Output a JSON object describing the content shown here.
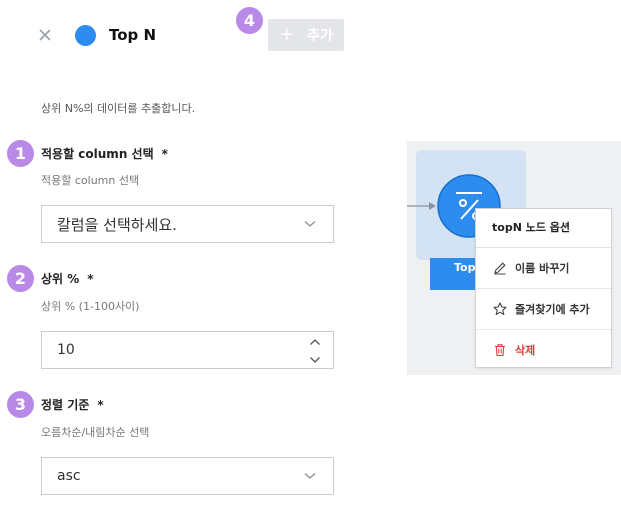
{
  "header": {
    "title": "Top N",
    "step_badge": "4",
    "add_button_icon": "plus",
    "add_button_label": "추가"
  },
  "description": "상위 N%의 데이터를 추출합니다.",
  "fields": [
    {
      "badge": "1",
      "label": "적용할 column 선택",
      "required": "*",
      "help": "적용할 column 선택",
      "value": "칼럼을 선택하세요."
    },
    {
      "badge": "2",
      "label": "상위 %",
      "required": "*",
      "help": "상위 % (1-100사이)",
      "value": "10"
    },
    {
      "badge": "3",
      "label": "정렬 기준",
      "required": "*",
      "help": "오름차순/내림차순 선택",
      "value": "asc"
    }
  ],
  "node": {
    "label": "Top"
  },
  "context_menu": {
    "title": "topN 노드 옵션",
    "items": [
      {
        "icon": "pencil-icon",
        "label": "이름 바꾸기"
      },
      {
        "icon": "star-icon",
        "label": "즐겨찾기에 추가"
      },
      {
        "icon": "trash-icon",
        "label": "삭제"
      }
    ]
  },
  "colors": {
    "accent": "#2d8cf0",
    "badge": "#b889e6",
    "danger": "#e03c3c"
  }
}
